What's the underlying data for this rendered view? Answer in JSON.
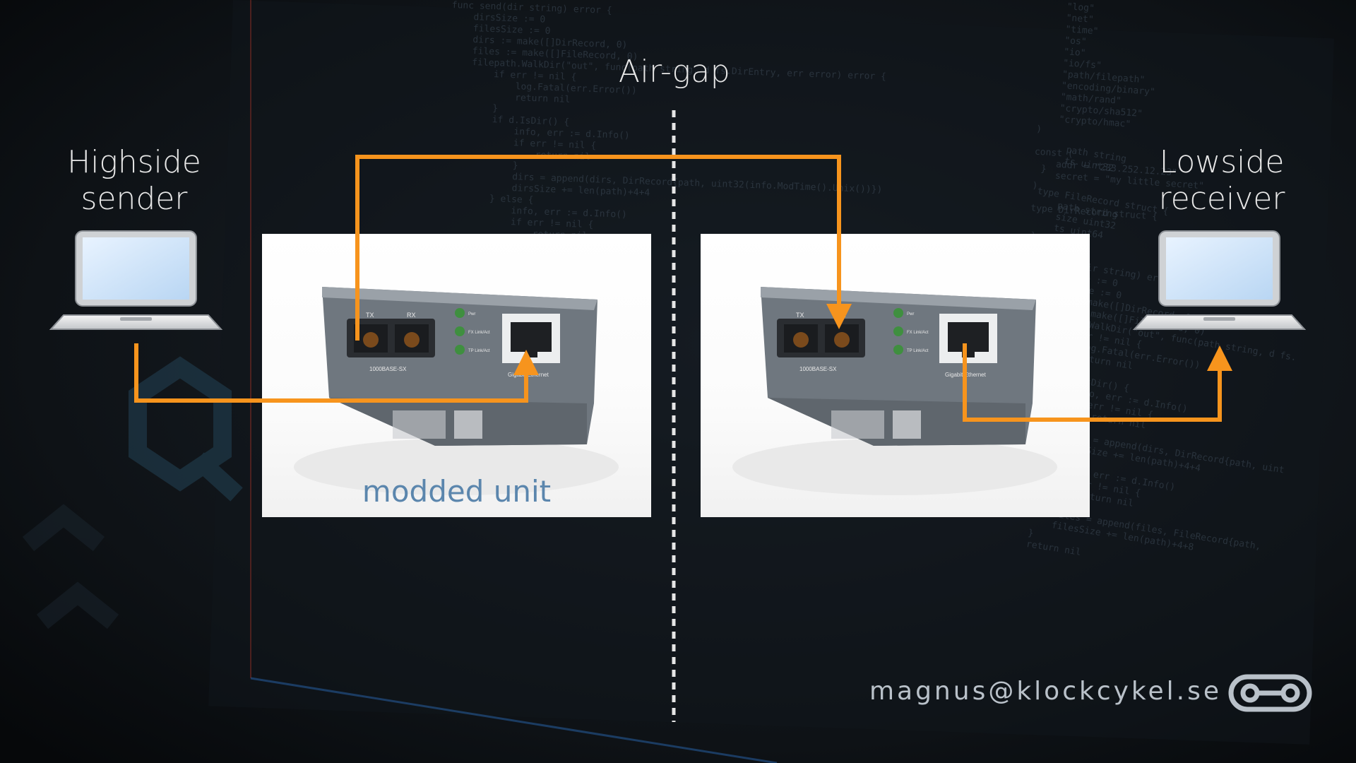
{
  "slide": {
    "airgap_label": "Air-gap",
    "highside_label_line1": "Highside",
    "highside_label_line2": "sender",
    "lowside_label_line1": "Lowside",
    "lowside_label_line2": "receiver",
    "modded_label": "modded unit",
    "email": "magnus@klockcykel.se"
  },
  "device": {
    "tx_label": "TX",
    "rx_label": "RX",
    "port_type_label": "1000BASE-SX",
    "ethernet_label": "Gigabit Ethernet",
    "led_labels": [
      "Pwr",
      "FX Link/Act",
      "TP Link/Act"
    ]
  },
  "icons": [
    "laptop-icon",
    "bike-chain-logo-icon"
  ],
  "colors": {
    "arrow": "#f7941d",
    "background": "#0b0d10",
    "label_text": "#e6e6e6",
    "modded_text": "#5b86ad",
    "device_body": "#7d858d"
  }
}
